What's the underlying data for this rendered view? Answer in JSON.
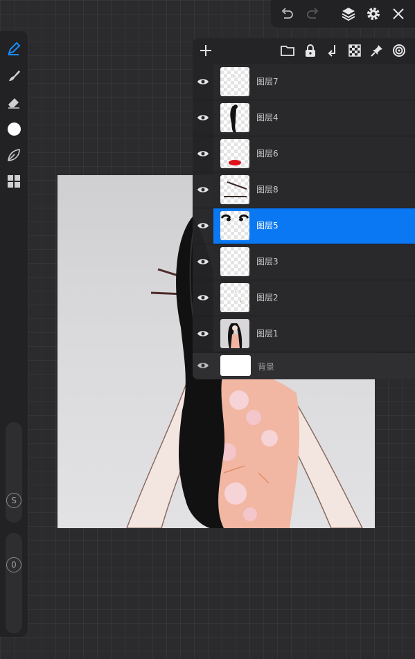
{
  "toolbar": {
    "tools": [
      {
        "icon": "brush-icon",
        "color": "#1a8cff"
      },
      {
        "icon": "smudge-icon"
      },
      {
        "icon": "eraser-icon"
      },
      {
        "icon": "color-swatch-icon",
        "color": "#ffffff"
      },
      {
        "icon": "selection-icon"
      },
      {
        "icon": "gallery-icon"
      }
    ],
    "size_knob_label": "S",
    "opacity_knob_label": "0"
  },
  "topbar": {
    "icons": [
      "undo-icon",
      "redo-icon",
      "layers-icon",
      "settings-icon",
      "close-icon"
    ]
  },
  "layers_panel": {
    "header_icons": [
      "add-layer-icon",
      "folder-icon",
      "lock-icon",
      "merge-down-icon",
      "checkerboard-icon",
      "pin-icon",
      "spiral-icon"
    ],
    "layers": [
      {
        "name": "图层7",
        "visible": true,
        "selected": false
      },
      {
        "name": "图层4",
        "visible": true,
        "selected": false
      },
      {
        "name": "图层6",
        "visible": true,
        "selected": false
      },
      {
        "name": "图层8",
        "visible": true,
        "selected": false
      },
      {
        "name": "图层5",
        "visible": true,
        "selected": true
      },
      {
        "name": "图层3",
        "visible": true,
        "selected": false
      },
      {
        "name": "图层2",
        "visible": true,
        "selected": false
      },
      {
        "name": "图层1",
        "visible": true,
        "selected": false
      }
    ],
    "background": {
      "name": "背景",
      "visible": true
    }
  },
  "colors": {
    "accent": "#0a78f2",
    "panel": "#242426",
    "canvas_bg": "#2b2b2d"
  }
}
